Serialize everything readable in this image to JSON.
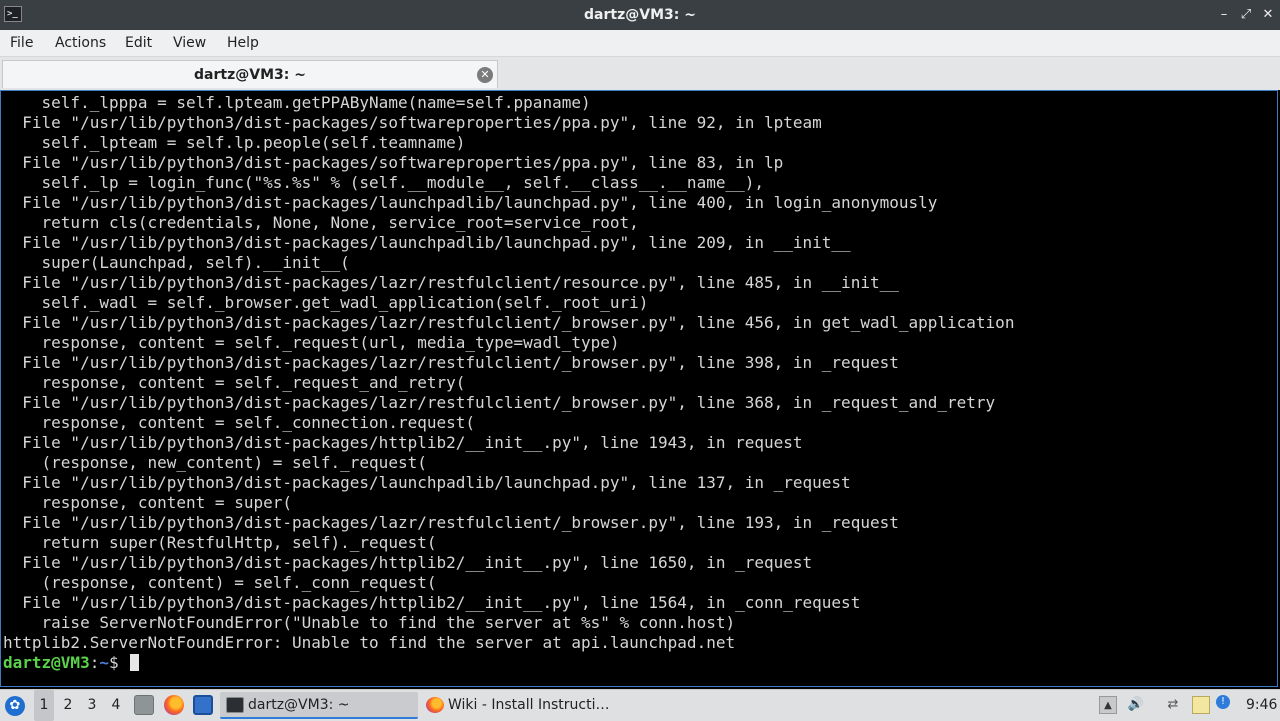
{
  "window": {
    "title": "dartz@VM3: ~",
    "app_icon": "terminal-icon",
    "controls": {
      "minimize": "–",
      "maximize": "⤢",
      "close": "✕"
    }
  },
  "menu": [
    "File",
    "Actions",
    "Edit",
    "View",
    "Help"
  ],
  "tab": {
    "label": "dartz@VM3: ~",
    "close": "✕"
  },
  "terminal": {
    "lines": [
      "    self._lpppa = self.lpteam.getPPAByName(name=self.ppaname)",
      "  File \"/usr/lib/python3/dist-packages/softwareproperties/ppa.py\", line 92, in lpteam",
      "    self._lpteam = self.lp.people(self.teamname)",
      "  File \"/usr/lib/python3/dist-packages/softwareproperties/ppa.py\", line 83, in lp",
      "    self._lp = login_func(\"%s.%s\" % (self.__module__, self.__class__.__name__),",
      "  File \"/usr/lib/python3/dist-packages/launchpadlib/launchpad.py\", line 400, in login_anonymously",
      "    return cls(credentials, None, None, service_root=service_root,",
      "  File \"/usr/lib/python3/dist-packages/launchpadlib/launchpad.py\", line 209, in __init__",
      "    super(Launchpad, self).__init__(",
      "  File \"/usr/lib/python3/dist-packages/lazr/restfulclient/resource.py\", line 485, in __init__",
      "    self._wadl = self._browser.get_wadl_application(self._root_uri)",
      "  File \"/usr/lib/python3/dist-packages/lazr/restfulclient/_browser.py\", line 456, in get_wadl_application",
      "    response, content = self._request(url, media_type=wadl_type)",
      "  File \"/usr/lib/python3/dist-packages/lazr/restfulclient/_browser.py\", line 398, in _request",
      "    response, content = self._request_and_retry(",
      "  File \"/usr/lib/python3/dist-packages/lazr/restfulclient/_browser.py\", line 368, in _request_and_retry",
      "    response, content = self._connection.request(",
      "  File \"/usr/lib/python3/dist-packages/httplib2/__init__.py\", line 1943, in request",
      "    (response, new_content) = self._request(",
      "  File \"/usr/lib/python3/dist-packages/launchpadlib/launchpad.py\", line 137, in _request",
      "    response, content = super(",
      "  File \"/usr/lib/python3/dist-packages/lazr/restfulclient/_browser.py\", line 193, in _request",
      "    return super(RestfulHttp, self)._request(",
      "  File \"/usr/lib/python3/dist-packages/httplib2/__init__.py\", line 1650, in _request",
      "    (response, content) = self._conn_request(",
      "  File \"/usr/lib/python3/dist-packages/httplib2/__init__.py\", line 1564, in _conn_request",
      "    raise ServerNotFoundError(\"Unable to find the server at %s\" % conn.host)",
      "httplib2.ServerNotFoundError: Unable to find the server at api.launchpad.net"
    ],
    "prompt": {
      "user": "dartz@VM3",
      "sep": ":",
      "path": "~",
      "symbol": "$ "
    }
  },
  "taskbar": {
    "start_icon": "lubuntu-logo-icon",
    "workspaces": [
      "1",
      "2",
      "3",
      "4"
    ],
    "active_workspace": "1",
    "tasks": [
      {
        "label": "dartz@VM3: ~",
        "icon": "terminal-icon",
        "active": true
      },
      {
        "label": "Wiki - Install Instructi…",
        "icon": "firefox-icon",
        "active": false
      }
    ],
    "clock": "9:46"
  },
  "colors": {
    "terminal_bg": "#000000",
    "terminal_fg": "#d6d6d6",
    "prompt_user": "#5ad34a",
    "prompt_path": "#4e7fd3",
    "terminal_border": "#3d7bc6",
    "active_task_underline": "#2f7bdc"
  }
}
